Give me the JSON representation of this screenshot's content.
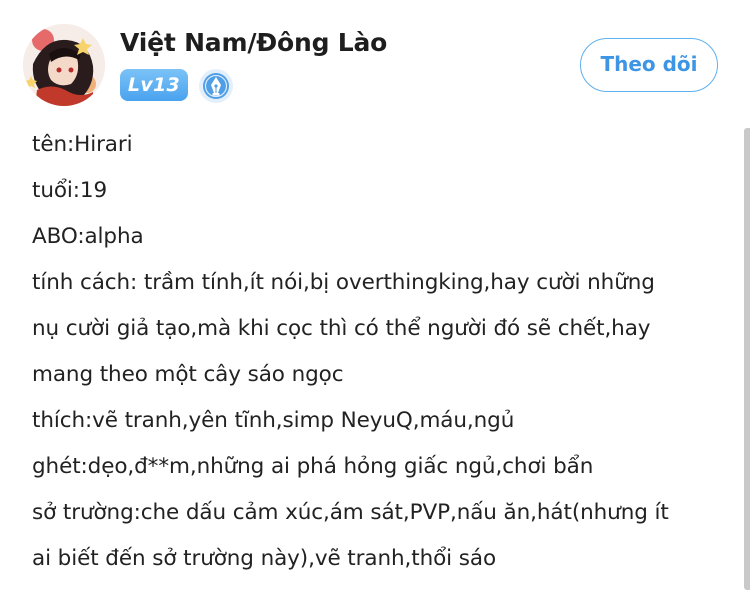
{
  "profile": {
    "username": "Việt Nam/Đông Lào",
    "level": "Lv13",
    "follow_label": "Theo dõi"
  },
  "post": {
    "lines": [
      "tên:Hirari",
      "tuổi:19",
      "ABO:alpha",
      "tính cách: trầm tính,ít nói,bị overthingking,hay cười những",
      "nụ cười giả tạo,mà khi cọc thì có thể người đó sẽ chết,hay",
      "mang theo một cây sáo ngọc",
      "thích:vẽ tranh,yên tĩnh,simp NeyuQ,máu,ngủ",
      "ghét:dẹo,đ**m,những ai phá hỏng giấc ngủ,chơi bẩn",
      "sở trường:che dấu cảm xúc,ám sát,PVP,nấu ăn,hát(nhưng ít",
      "ai biết đến sở trường này),vẽ tranh,thổi sáo"
    ]
  },
  "colors": {
    "accent": "#3d95e3",
    "level_badge": "#5aaef2",
    "text": "#222222"
  },
  "icons": {
    "title_badge": "pen-nib-badge-icon"
  }
}
